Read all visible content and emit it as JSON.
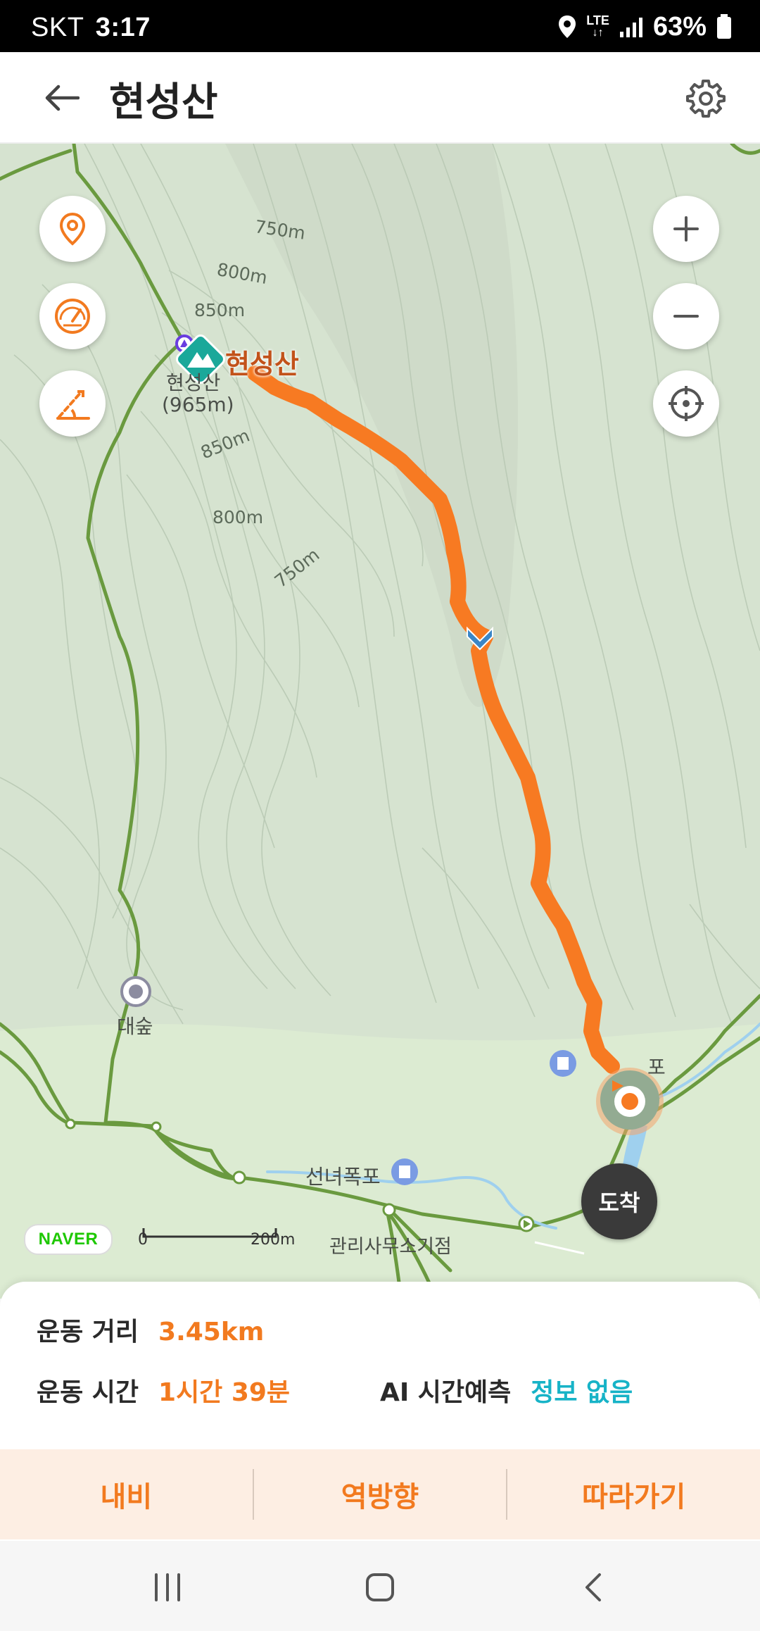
{
  "status_bar": {
    "carrier": "SKT",
    "time": "3:17",
    "network": "LTE",
    "battery": "63%"
  },
  "header": {
    "title": "현성산",
    "back_icon": "back-arrow-icon",
    "settings_icon": "gear-icon"
  },
  "map": {
    "peak_label": "현성산",
    "peak_name_small": "현성산",
    "peak_elevation": "(965m)",
    "contours": [
      "750m",
      "800m",
      "850m",
      "850m",
      "800m",
      "750m"
    ],
    "poi_daesup": "대숲",
    "poi_waterfall": "선녀폭포",
    "poi_office": "관리사무소기점",
    "poi_partial": "포",
    "scale_start": "0",
    "scale_end": "200m",
    "brand": "NAVER",
    "arrive_label": "도착",
    "route_color": "#f77a22",
    "trail_color": "#6a9a3f"
  },
  "info": {
    "distance_label": "운동 거리",
    "distance_value": "3.45km",
    "time_label": "운동 시간",
    "time_value": "1시간 39분",
    "ai_label": "AI 시간예측",
    "ai_value": "정보 없음"
  },
  "actions": {
    "navi": "내비",
    "reverse": "역방향",
    "follow": "따라가기"
  },
  "colors": {
    "accent": "#f27a1f",
    "teal": "#17b3c7"
  }
}
